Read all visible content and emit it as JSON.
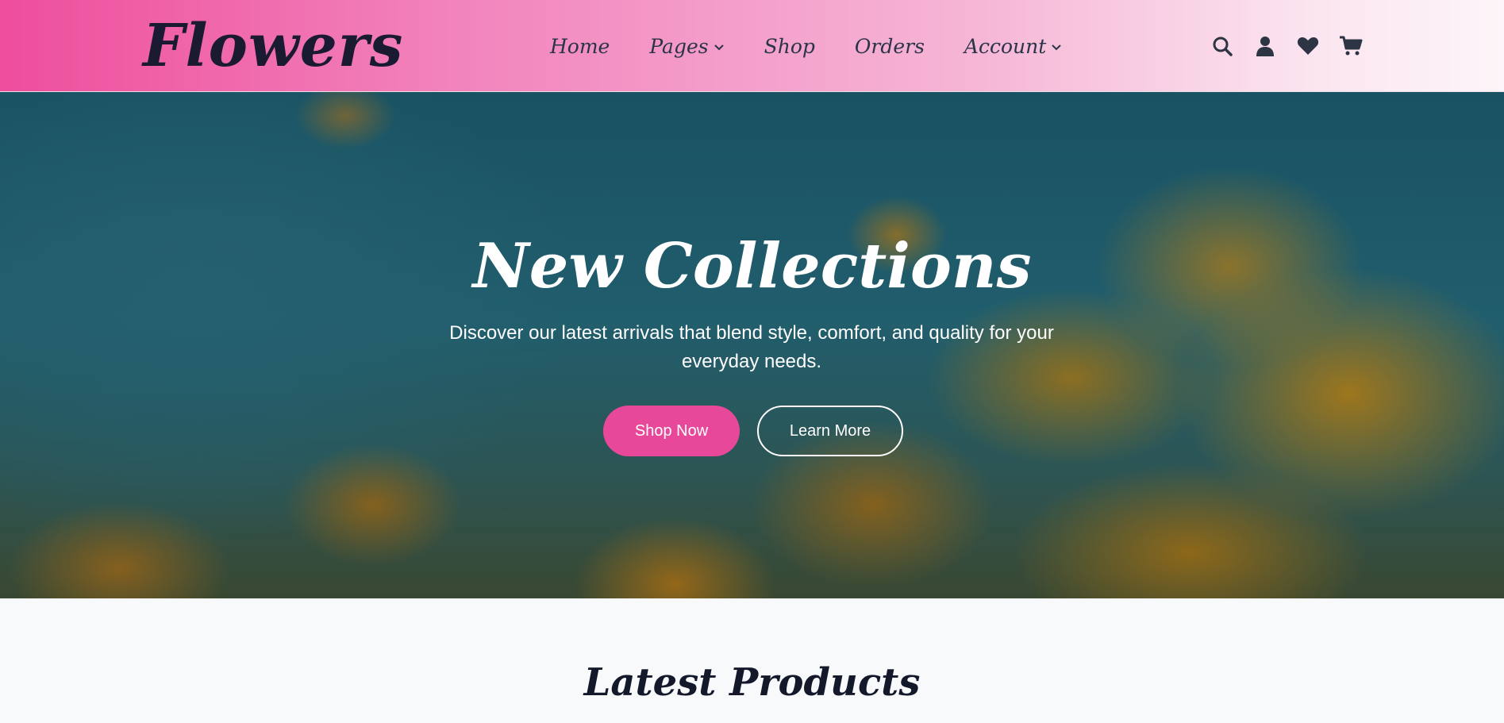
{
  "brand": {
    "logo": "Flowers"
  },
  "nav": {
    "items": [
      {
        "label": "Home",
        "dropdown": false
      },
      {
        "label": "Pages",
        "dropdown": true
      },
      {
        "label": "Shop",
        "dropdown": false
      },
      {
        "label": "Orders",
        "dropdown": false
      },
      {
        "label": "Account",
        "dropdown": true
      }
    ]
  },
  "header_icons": [
    "search-icon",
    "user-icon",
    "heart-icon",
    "cart-icon"
  ],
  "hero": {
    "title": "New Collections",
    "subtitle": "Discover our latest arrivals that blend style, comfort, and quality for your everyday needs.",
    "primary_button": "Shop Now",
    "secondary_button": "Learn More"
  },
  "products_section": {
    "title": "Latest Products"
  },
  "colors": {
    "accent": "#e8489a",
    "header_gradient_start": "#ee4e9c",
    "header_gradient_end": "#fdf5f9",
    "text_dark": "#1a1b33"
  }
}
